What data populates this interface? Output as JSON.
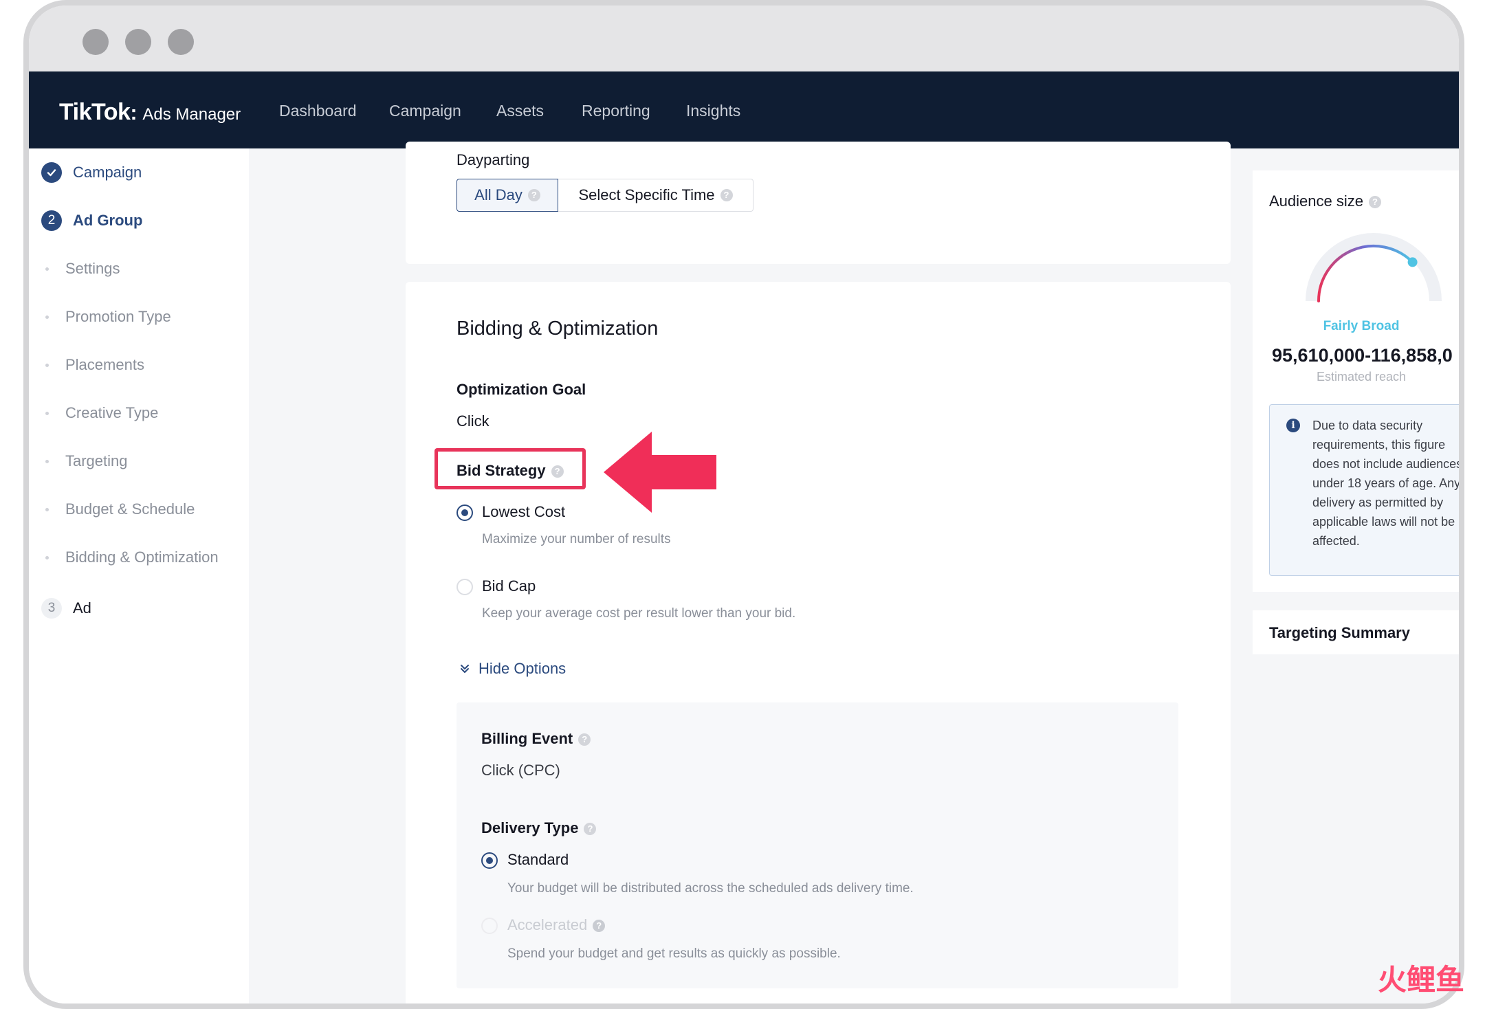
{
  "nav": {
    "logo_brand": "TikTok",
    "logo_product": "Ads Manager",
    "items": [
      "Dashboard",
      "Campaign",
      "Assets",
      "Reporting",
      "Insights"
    ]
  },
  "sidebar": {
    "steps": [
      {
        "number": "",
        "label": "Campaign",
        "state": "done"
      },
      {
        "number": "2",
        "label": "Ad Group",
        "state": "active"
      },
      {
        "number": "3",
        "label": "Ad",
        "state": "pending"
      }
    ],
    "substeps": [
      "Settings",
      "Promotion Type",
      "Placements",
      "Creative Type",
      "Targeting",
      "Budget & Schedule",
      "Bidding & Optimization"
    ]
  },
  "dayparting": {
    "label": "Dayparting",
    "options": [
      "All Day",
      "Select Specific Time"
    ],
    "selected": "All Day"
  },
  "bidding": {
    "title": "Bidding & Optimization",
    "optimization_goal_label": "Optimization Goal",
    "optimization_goal_value": "Click",
    "bid_strategy_label": "Bid Strategy",
    "strategies": [
      {
        "label": "Lowest Cost",
        "description": "Maximize your number of results",
        "selected": true
      },
      {
        "label": "Bid Cap",
        "description": "Keep your average cost per result lower than your bid.",
        "selected": false
      }
    ],
    "hide_options": "Hide Options",
    "billing_event_label": "Billing Event",
    "billing_event_value": "Click (CPC)",
    "delivery_type_label": "Delivery Type",
    "delivery_types": [
      {
        "label": "Standard",
        "description": "Your budget will be distributed across the scheduled ads delivery time.",
        "selected": true,
        "disabled": false
      },
      {
        "label": "Accelerated",
        "description": "Spend your budget and get results as quickly as possible.",
        "selected": false,
        "disabled": true
      }
    ]
  },
  "audience": {
    "title": "Audience size",
    "gauge_label": "Fairly Broad",
    "gauge_level": 0.75,
    "reach": "95,610,000-116,858,0",
    "reach_caption": "Estimated reach",
    "notice": "Due to data security requirements, this figure does not include audiences under 18 years of age. Any delivery as permitted by applicable laws will not be affected."
  },
  "targeting_summary": {
    "title": "Targeting Summary"
  },
  "watermark": "火鲤鱼",
  "colors": {
    "nav_bg": "#0f1d33",
    "primary": "#2b4a7e",
    "highlight": "#e8345a",
    "gauge_accent": "#4fc3e3"
  }
}
